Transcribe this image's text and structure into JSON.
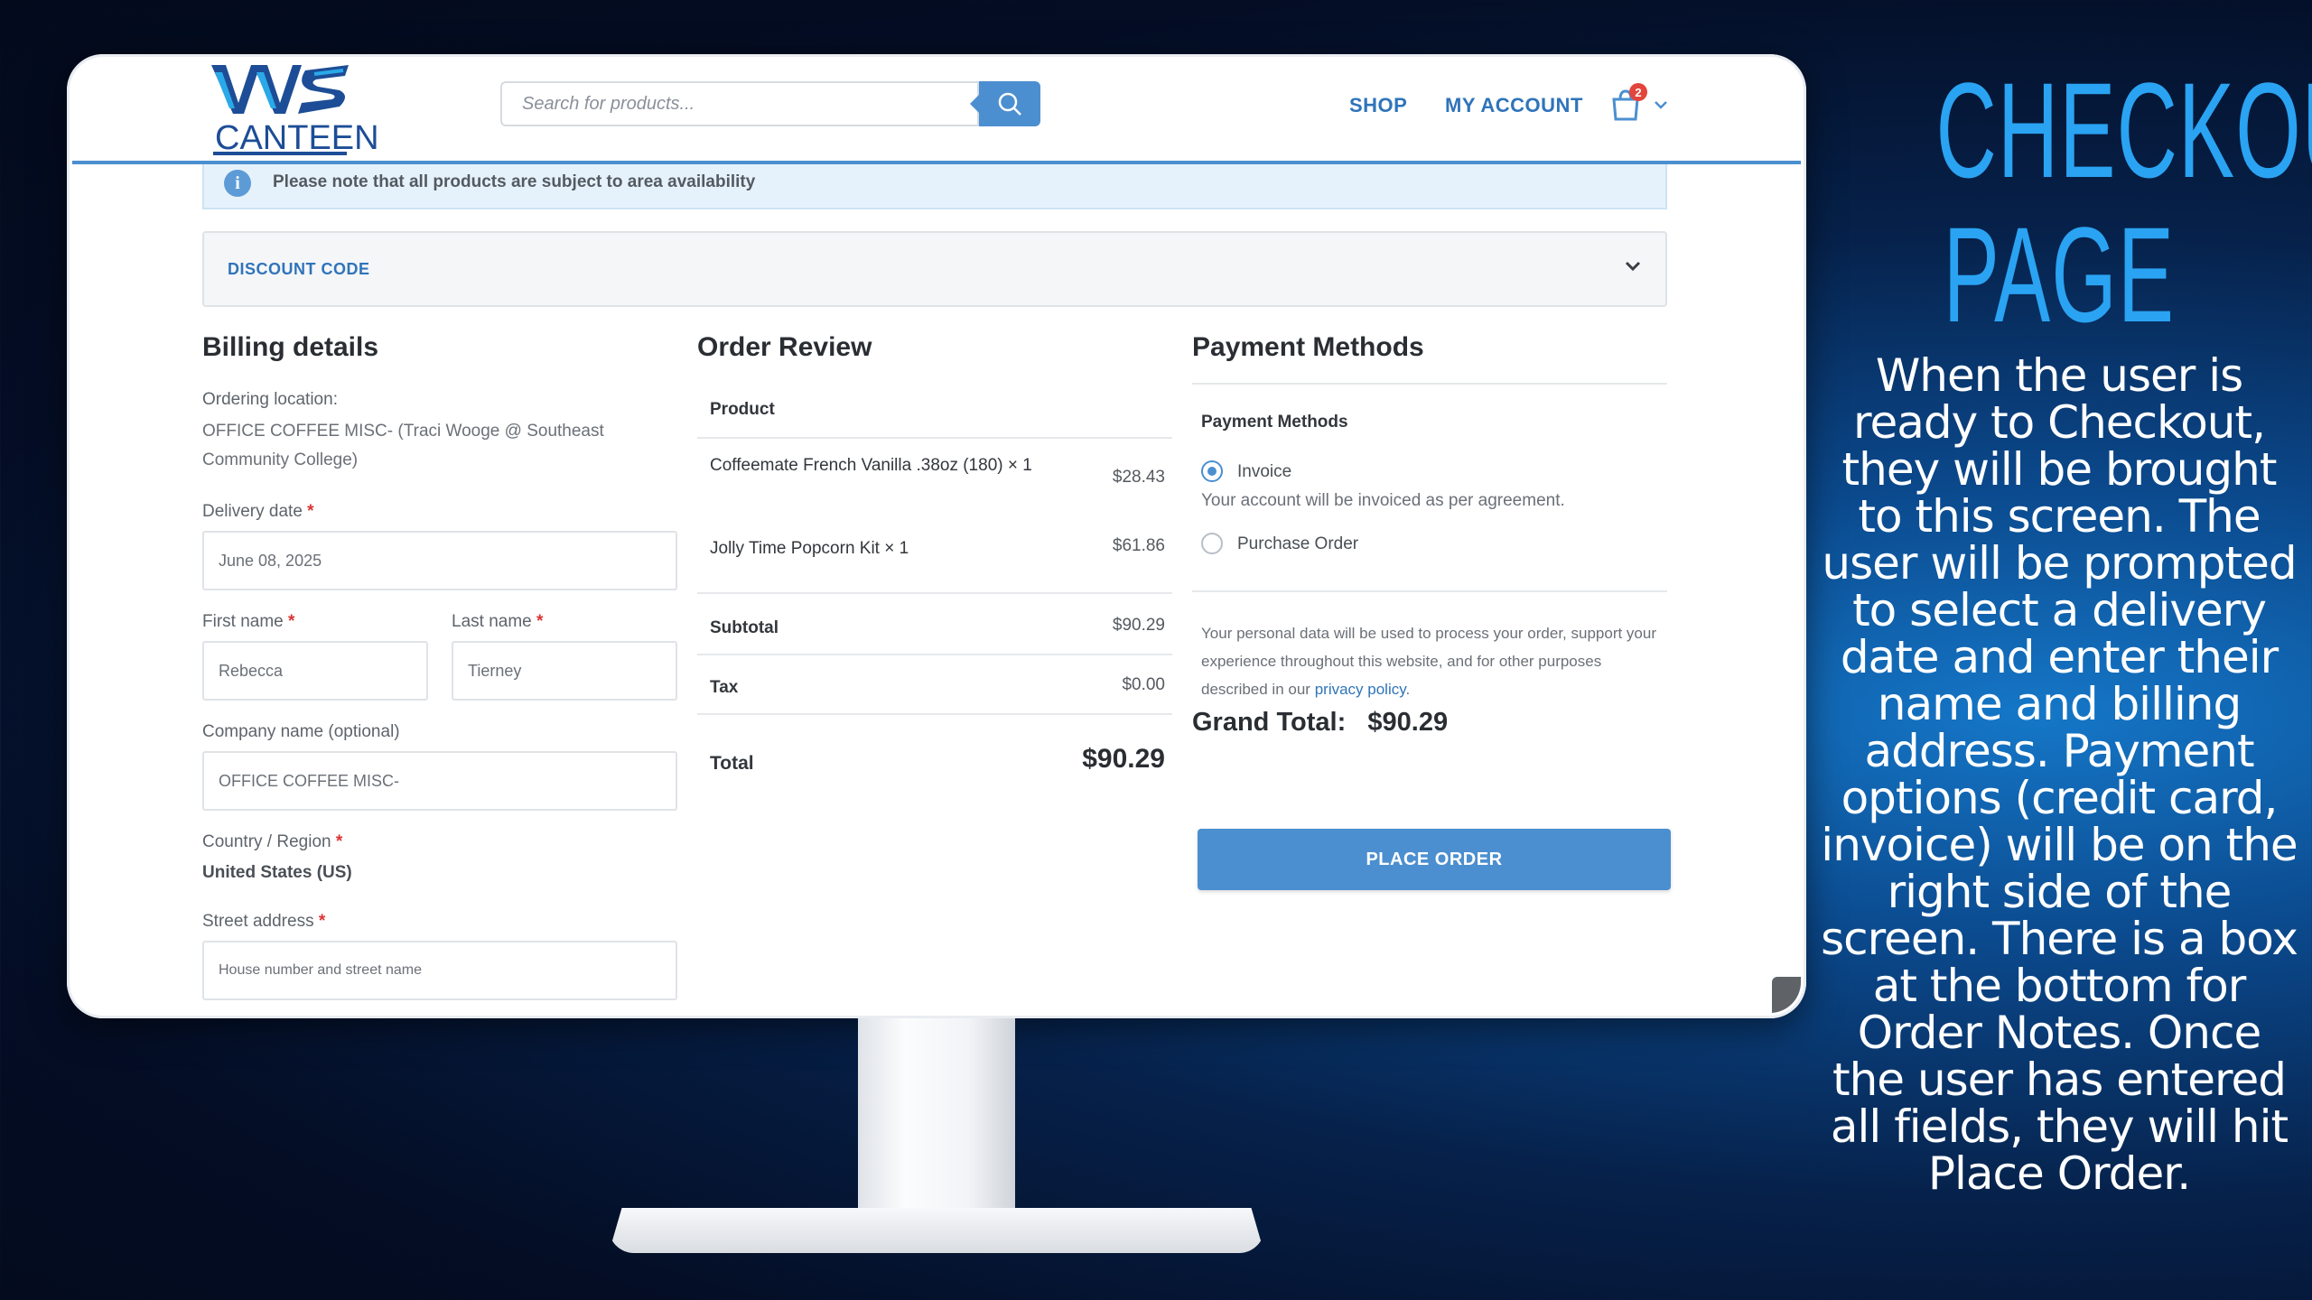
{
  "header": {
    "logo_text": "CANTEEN",
    "search_placeholder": "Search for products...",
    "nav": {
      "shop": "SHOP",
      "account": "MY ACCOUNT"
    },
    "cart_count": "2"
  },
  "notice": "Please note that all products are subject to area availability",
  "discount_label": "DISCOUNT CODE",
  "billing": {
    "title": "Billing details",
    "ordering_location_label": "Ordering location:",
    "ordering_location_value": "OFFICE COFFEE MISC- (Traci Wooge @ Southeast Community College)",
    "delivery_label": "Delivery date",
    "delivery_value": "June 08, 2025",
    "first_label": "First name",
    "first_value": "Rebecca",
    "last_label": "Last name",
    "last_value": "Tierney",
    "company_label": "Company name (optional)",
    "company_value": "OFFICE COFFEE MISC-",
    "country_label": "Country / Region",
    "country_value": "United States (US)",
    "street_label": "Street address",
    "street_placeholder": "House number and street name",
    "required_mark": "*"
  },
  "order": {
    "title": "Order Review",
    "product_header": "Product",
    "items": [
      {
        "name": "Coffeemate French Vanilla .38oz (180) × 1",
        "price": "$28.43"
      },
      {
        "name": "Jolly Time Popcorn Kit  × 1",
        "price": "$61.86"
      }
    ],
    "subtotal_label": "Subtotal",
    "subtotal": "$90.29",
    "tax_label": "Tax",
    "tax": "$0.00",
    "total_label": "Total",
    "total": "$90.29"
  },
  "payment": {
    "title": "Payment Methods",
    "subtitle": "Payment Methods",
    "invoice_label": "Invoice",
    "invoice_desc": "Your account will be invoiced as per agreement.",
    "po_label": "Purchase Order",
    "privacy_text": "Your personal data will be used to process your order, support your experience throughout this website, and for other purposes described in our",
    "privacy_link": "privacy policy",
    "grand_total_label": "Grand Total:",
    "grand_total": "$90.29",
    "place_order": "PLACE ORDER"
  },
  "side": {
    "title": "CHECKOUT PAGE",
    "description": "When the user is ready to Checkout, they will be brought to this screen. The user will be prompted to select a delivery date and enter their name and billing address. Payment options (credit card, invoice) will be on the right side of the screen. There is a box at the bottom for Order Notes. Once the user has entered all fields, they will hit Place Order."
  },
  "colors": {
    "accent": "#4b8fd0",
    "link": "#2f74ba",
    "side_title": "#2aa3f2"
  }
}
